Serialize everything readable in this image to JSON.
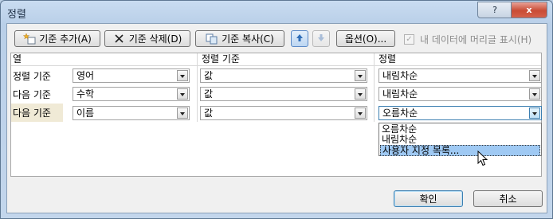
{
  "window": {
    "title": "정렬",
    "help_label": "?",
    "close_label": "x"
  },
  "toolbar": {
    "add_label": "기준 추가(A)",
    "delete_label": "기준 삭제(D)",
    "copy_label": "기준 복사(C)",
    "options_label": "옵션(O)...",
    "header_checkbox_label": "내 데이터에 머리글 표시(H)",
    "header_checkbox_checked": true
  },
  "grid": {
    "headers": {
      "column": "열",
      "sort_on": "정렬 기준",
      "order": "정렬"
    },
    "rows": [
      {
        "label": "정렬 기준",
        "column": "영어",
        "sort_on": "값",
        "order": "내림차순"
      },
      {
        "label": "다음 기준",
        "column": "수학",
        "sort_on": "값",
        "order": "내림차순"
      },
      {
        "label": "다음 기준",
        "column": "이름",
        "sort_on": "값",
        "order": "오름차순"
      }
    ]
  },
  "dropdown": {
    "options": [
      "오름차순",
      "내림차순",
      "사용자 지정 목록..."
    ],
    "highlighted": "사용자 지정 목록..."
  },
  "footer": {
    "ok_label": "확인",
    "cancel_label": "취소"
  },
  "colors": {
    "accent": "#3c7fb1",
    "highlight": "#9fc9f3",
    "selected_row_label": "#f0ead6"
  }
}
